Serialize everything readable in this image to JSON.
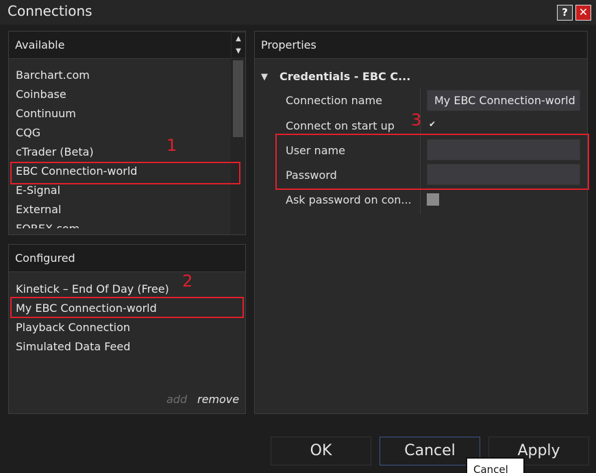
{
  "window": {
    "title": "Connections",
    "help_label": "?",
    "close_label": "✕"
  },
  "available": {
    "header": "Available",
    "items": [
      {
        "label": "Barchart.com"
      },
      {
        "label": "Coinbase"
      },
      {
        "label": "Continuum"
      },
      {
        "label": "CQG"
      },
      {
        "label": "cTrader (Beta)"
      },
      {
        "label": "EBC Connection-world"
      },
      {
        "label": "E-Signal"
      },
      {
        "label": "External"
      },
      {
        "label": "FOREX.com"
      }
    ],
    "scroll_up": "▲",
    "scroll_down": "▼"
  },
  "configured": {
    "header": "Configured",
    "items": [
      {
        "label": "Kinetick – End Of Day (Free)"
      },
      {
        "label": "My EBC Connection-world"
      },
      {
        "label": "Playback Connection"
      },
      {
        "label": "Simulated Data Feed"
      }
    ],
    "add_label": "add",
    "remove_label": "remove"
  },
  "properties": {
    "header": "Properties",
    "section_title": "Credentials - EBC C...",
    "rows": {
      "connection_name": {
        "label": "Connection name",
        "value": "My EBC Connection-world"
      },
      "connect_on_startup": {
        "label": "Connect on start up",
        "checked": true
      },
      "user_name": {
        "label": "User name",
        "value": ""
      },
      "password": {
        "label": "Password",
        "value": ""
      },
      "ask_password": {
        "label": "Ask password on con...",
        "checked": false
      }
    }
  },
  "annotations": {
    "one": "1",
    "two": "2",
    "three": "3"
  },
  "footer": {
    "ok_label": "OK",
    "cancel_label": "Cancel",
    "apply_label": "Apply",
    "tooltip": "Cancel"
  },
  "colors": {
    "annotation_red": "#e1202b",
    "close_red": "#c81e1e",
    "background": "#1e1e1e"
  }
}
